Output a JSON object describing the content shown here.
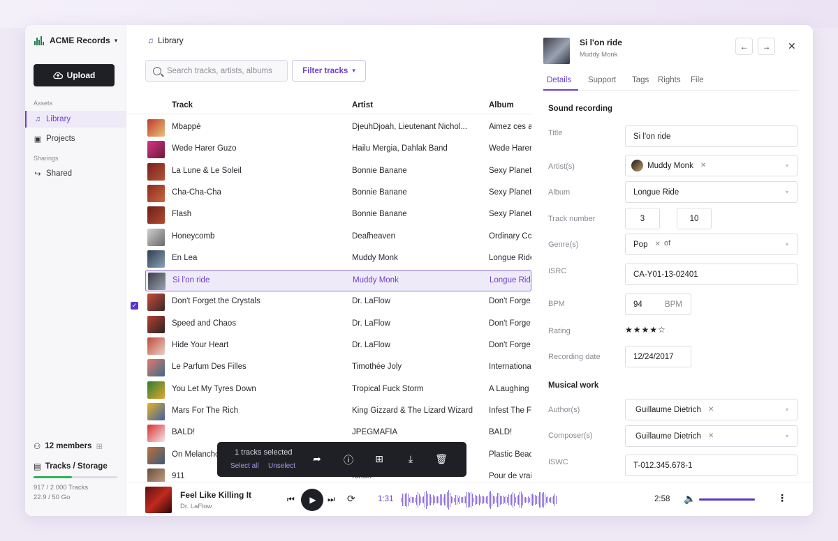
{
  "brand": {
    "name": "ACME Records"
  },
  "sidebar": {
    "upload_label": "Upload",
    "section_assets": "Assets",
    "items": [
      {
        "label": "Library"
      },
      {
        "label": "Projects"
      }
    ],
    "section_sharings": "Sharings",
    "shared_label": "Shared",
    "members_label": "12 members",
    "storage_label": "Tracks / Storage",
    "tracks_usage": "917 / 2 000 Tracks",
    "storage_usage": "22.9 / 50 Go",
    "tracks_fraction": 0.46
  },
  "main": {
    "breadcrumb": "Library",
    "search_placeholder": "Search tracks, artists, albums",
    "filter_label": "Filter tracks",
    "columns": [
      "Track",
      "Artist",
      "Album"
    ],
    "rows": [
      {
        "track": "Mbappé",
        "artist": "DjeuhDjoah, Lieutenant Nichol...",
        "album": "Aimez ces a"
      },
      {
        "track": "Wede Harer Guzo",
        "artist": "Hailu Mergia, Dahlak Band",
        "album": "Wede Harer"
      },
      {
        "track": "La Lune & Le Soleil",
        "artist": "Bonnie Banane",
        "album": "Sexy Planet"
      },
      {
        "track": "Cha-Cha-Cha",
        "artist": "Bonnie Banane",
        "album": "Sexy Planet"
      },
      {
        "track": "Flash",
        "artist": "Bonnie Banane",
        "album": "Sexy Planet"
      },
      {
        "track": "Honeycomb",
        "artist": "Deafheaven",
        "album": "Ordinary Cc"
      },
      {
        "track": "En Lea",
        "artist": "Muddy Monk",
        "album": "Longue Ride"
      },
      {
        "track": "Si l'on ride",
        "artist": "Muddy Monk",
        "album": "Longue Ride"
      },
      {
        "track": "Don't Forget the Crystals",
        "artist": "Dr. LaFlow",
        "album": "Don't Forge"
      },
      {
        "track": "Speed and Chaos",
        "artist": "Dr. LaFlow",
        "album": "Don't Forge"
      },
      {
        "track": "Hide Your Heart",
        "artist": "Dr. LaFlow",
        "album": "Don't Forge"
      },
      {
        "track": "Le Parfum Des Filles",
        "artist": "Timothée Joly",
        "album": "Internationa"
      },
      {
        "track": "You Let My Tyres Down",
        "artist": "Tropical Fuck Storm",
        "album": "A Laughing"
      },
      {
        "track": "Mars For The Rich",
        "artist": "King Gizzard & The Lizard Wizard",
        "album": "Infest The F"
      },
      {
        "track": "BALD!",
        "artist": "JPEGMAFIA",
        "album": "BALD!"
      },
      {
        "track": "On Melancho",
        "artist": "",
        "album": "Plastic Beac"
      },
      {
        "track": "911",
        "artist": "Ichon",
        "album": "Pour de vrai"
      }
    ]
  },
  "selection": {
    "count_label": "1 tracks selected",
    "select_all": "Select all",
    "unselect": "Unselect"
  },
  "details": {
    "title": "Si l'on ride",
    "artist": "Muddy Monk",
    "tabs": [
      "Details",
      "Support",
      "Tags",
      "Rights",
      "File"
    ],
    "section_recording": "Sound recording",
    "labels": {
      "title": "Title",
      "artists": "Artist(s)",
      "album": "Album",
      "track_number": "Track number",
      "genres": "Genre(s)",
      "isrc": "ISRC",
      "bpm": "BPM",
      "rating": "Rating",
      "recording_date": "Recording date",
      "authors": "Author(s)",
      "composers": "Composer(s)",
      "iswc": "ISWC"
    },
    "values": {
      "title": "Si l'on ride",
      "artist": "Muddy Monk",
      "album": "Longue Ride",
      "track_number": "3",
      "of_label": "of",
      "track_total": "10",
      "genre": "Pop",
      "isrc": "CA-Y01-13-02401",
      "bpm": "94",
      "bpm_unit": "BPM",
      "rating_stars": "★★★★☆",
      "rating": 4,
      "recording_date": "12/24/2017",
      "author": "Guillaume Dietrich",
      "composer": "Guillaume Dietrich",
      "iswc": "T-012.345.678-1"
    },
    "section_musical": "Musical work"
  },
  "player": {
    "title": "Feel Like Killing It",
    "artist": "Dr. LaFlow",
    "current_time": "1:31",
    "duration": "2:58",
    "volume": 1.0
  },
  "colors": {
    "accent": "#6b3fd0",
    "dark": "#1f2025",
    "success": "#2bb35a"
  }
}
